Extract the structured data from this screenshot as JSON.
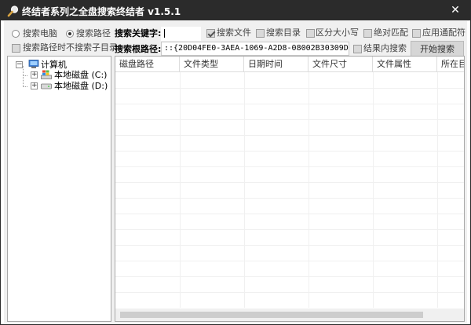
{
  "window": {
    "title": "终结者系列之全盘搜索终结者 v1.5.1",
    "close_label": "✕"
  },
  "options": {
    "search_computer_label": "搜索电脑",
    "search_computer_selected": false,
    "search_path_label": "搜索路径",
    "search_path_selected": true,
    "no_subdir_label": "搜索路径时不搜索子目录",
    "no_subdir_checked": false
  },
  "search": {
    "keyword_label": "搜索关键字:",
    "keyword_value": "",
    "search_files_label": "搜索文件",
    "search_files_checked": true,
    "search_dirs_label": "搜索目录",
    "search_dirs_checked": false,
    "case_sensitive_label": "区分大小写",
    "case_sensitive_checked": false,
    "exact_match_label": "绝对匹配",
    "exact_match_checked": false,
    "wildcard_label": "应用通配符",
    "wildcard_checked": false,
    "root_path_label": "搜索根路径:",
    "root_path_value": "::{20D04FE0-3AEA-1069-A2D8-08002B30309D}",
    "search_in_results_label": "结果内搜索",
    "search_in_results_checked": false,
    "start_button_label": "开始搜索"
  },
  "tree": {
    "root_label": "计算机",
    "root_expander": "−",
    "drives": [
      {
        "label": "本地磁盘 (C:)",
        "expander": "+",
        "icon": "windows-drive-icon"
      },
      {
        "label": "本地磁盘 (D:)",
        "expander": "+",
        "icon": "drive-icon"
      }
    ]
  },
  "results": {
    "columns": [
      "磁盘路径",
      "文件类型",
      "日期时间",
      "文件尺寸",
      "文件属性",
      "所在目录"
    ],
    "rows": []
  }
}
